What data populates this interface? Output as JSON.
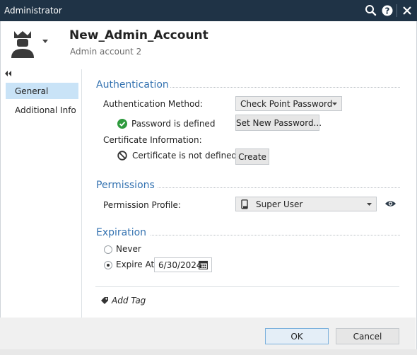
{
  "window": {
    "title": "Administrator"
  },
  "header": {
    "object_name": "New_Admin_Account",
    "object_comment": "Admin account 2"
  },
  "sidebar": {
    "items": [
      {
        "label": "General",
        "selected": true
      },
      {
        "label": "Additional Info",
        "selected": false
      }
    ]
  },
  "authentication": {
    "section_title": "Authentication",
    "method_label": "Authentication Method:",
    "method_value": "Check Point Password",
    "password_status": "Password is defined",
    "set_password_button": "Set New Password...",
    "certificate_label": "Certificate Information:",
    "certificate_status": "Certificate is not defined",
    "create_button": "Create"
  },
  "permissions": {
    "section_title": "Permissions",
    "profile_label": "Permission Profile:",
    "profile_value": "Super User"
  },
  "expiration": {
    "section_title": "Expiration",
    "never_label": "Never",
    "never_selected": false,
    "expire_at_label": "Expire At:",
    "expire_at_selected": true,
    "expire_date": "6/30/2024"
  },
  "tags": {
    "add_tag_label": "Add Tag"
  },
  "footer": {
    "ok_label": "OK",
    "cancel_label": "Cancel"
  },
  "colors": {
    "titlebar": "#1f3346",
    "section_title": "#3573b1",
    "nav_selected": "#c9e3f7",
    "status_ok": "#2e9a3d"
  },
  "icons": {
    "titlebar": [
      "search-icon",
      "help-icon",
      "close-icon"
    ],
    "avatar": "admin-crown-icon",
    "password_status": "check-circle-icon",
    "certificate_status": "no-entry-icon",
    "profile": "device-icon",
    "view_profile": "eye-icon",
    "date": "calendar-icon",
    "tag": "tag-icon"
  }
}
